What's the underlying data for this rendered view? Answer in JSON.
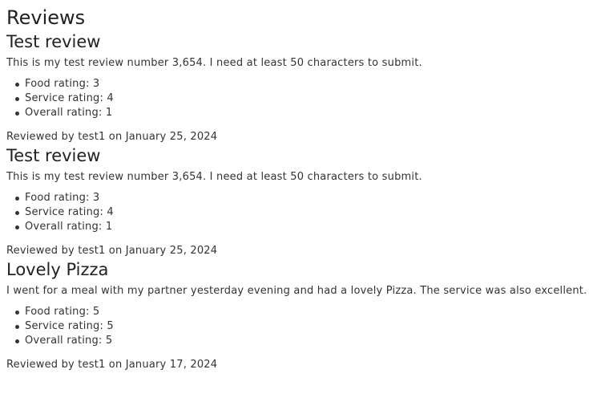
{
  "page_title": "Reviews",
  "reviews": [
    {
      "title": "Test review",
      "body": "This is my test review number 3,654. I need at least 50 characters to submit.",
      "ratings": [
        "Food rating: 3",
        "Service rating: 4",
        "Overall rating: 1"
      ],
      "meta": "Reviewed by test1 on January 25, 2024"
    },
    {
      "title": "Test review",
      "body": "This is my test review number 3,654. I need at least 50 characters to submit.",
      "ratings": [
        "Food rating: 3",
        "Service rating: 4",
        "Overall rating: 1"
      ],
      "meta": "Reviewed by test1 on January 25, 2024"
    },
    {
      "title": "Lovely Pizza",
      "body": "I went for a meal with my partner yesterday evening and had a lovely Pizza. The service was also excellent.",
      "ratings": [
        "Food rating: 5",
        "Service rating: 5",
        "Overall rating: 5"
      ],
      "meta": "Reviewed by test1 on January 17, 2024"
    }
  ]
}
